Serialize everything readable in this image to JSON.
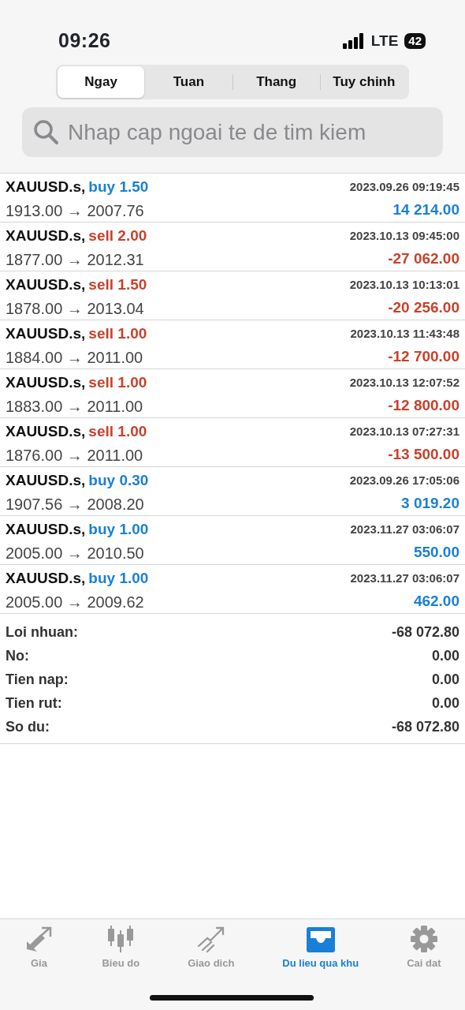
{
  "status_bar": {
    "time": "09:26",
    "network": "LTE",
    "battery": "42"
  },
  "tabs": [
    {
      "label": "Ngay",
      "selected": true
    },
    {
      "label": "Tuan",
      "selected": false
    },
    {
      "label": "Thang",
      "selected": false
    },
    {
      "label": "Tuy chinh",
      "selected": false
    }
  ],
  "search": {
    "placeholder": "Nhap cap ngoai te de tim kiem"
  },
  "trades": [
    {
      "symbol": "XAUUSD.s,",
      "kind": "buy",
      "order": "buy 1.50",
      "time": "2023.09.26 09:19:45",
      "prices": "1913.00 → 2007.76",
      "profit": "14 214.00"
    },
    {
      "symbol": "XAUUSD.s,",
      "kind": "sell",
      "order": "sell 2.00",
      "time": "2023.10.13 09:45:00",
      "prices": "1877.00 → 2012.31",
      "profit": "-27 062.00"
    },
    {
      "symbol": "XAUUSD.s,",
      "kind": "sell",
      "order": "sell 1.50",
      "time": "2023.10.13 10:13:01",
      "prices": "1878.00 → 2013.04",
      "profit": "-20 256.00"
    },
    {
      "symbol": "XAUUSD.s,",
      "kind": "sell",
      "order": "sell 1.00",
      "time": "2023.10.13 11:43:48",
      "prices": "1884.00 → 2011.00",
      "profit": "-12 700.00"
    },
    {
      "symbol": "XAUUSD.s,",
      "kind": "sell",
      "order": "sell 1.00",
      "time": "2023.10.13 12:07:52",
      "prices": "1883.00 → 2011.00",
      "profit": "-12 800.00"
    },
    {
      "symbol": "XAUUSD.s,",
      "kind": "sell",
      "order": "sell 1.00",
      "time": "2023.10.13 07:27:31",
      "prices": "1876.00 → 2011.00",
      "profit": "-13 500.00"
    },
    {
      "symbol": "XAUUSD.s,",
      "kind": "buy",
      "order": "buy 0.30",
      "time": "2023.09.26 17:05:06",
      "prices": "1907.56 → 2008.20",
      "profit": "3 019.20"
    },
    {
      "symbol": "XAUUSD.s,",
      "kind": "buy",
      "order": "buy 1.00",
      "time": "2023.11.27 03:06:07",
      "prices": "2005.00 → 2010.50",
      "profit": "550.00"
    },
    {
      "symbol": "XAUUSD.s,",
      "kind": "buy",
      "order": "buy 1.00",
      "time": "2023.11.27 03:06:07",
      "prices": "2005.00 → 2009.62",
      "profit": "462.00"
    }
  ],
  "summary": [
    {
      "label": "Loi nhuan:",
      "value": "-68 072.80"
    },
    {
      "label": "No:",
      "value": "0.00"
    },
    {
      "label": "Tien nap:",
      "value": "0.00"
    },
    {
      "label": "Tien rut:",
      "value": "0.00"
    },
    {
      "label": "So du:",
      "value": "-68 072.80"
    }
  ],
  "bottom_nav": [
    {
      "label": "Gia",
      "kind": "quotes",
      "selected": false
    },
    {
      "label": "Bieu do",
      "kind": "chart",
      "selected": false
    },
    {
      "label": "Giao dich",
      "kind": "trade",
      "selected": false
    },
    {
      "label": "Du lieu qua khu",
      "kind": "history",
      "selected": true
    },
    {
      "label": "Cai dat",
      "kind": "settings",
      "selected": false
    }
  ]
}
